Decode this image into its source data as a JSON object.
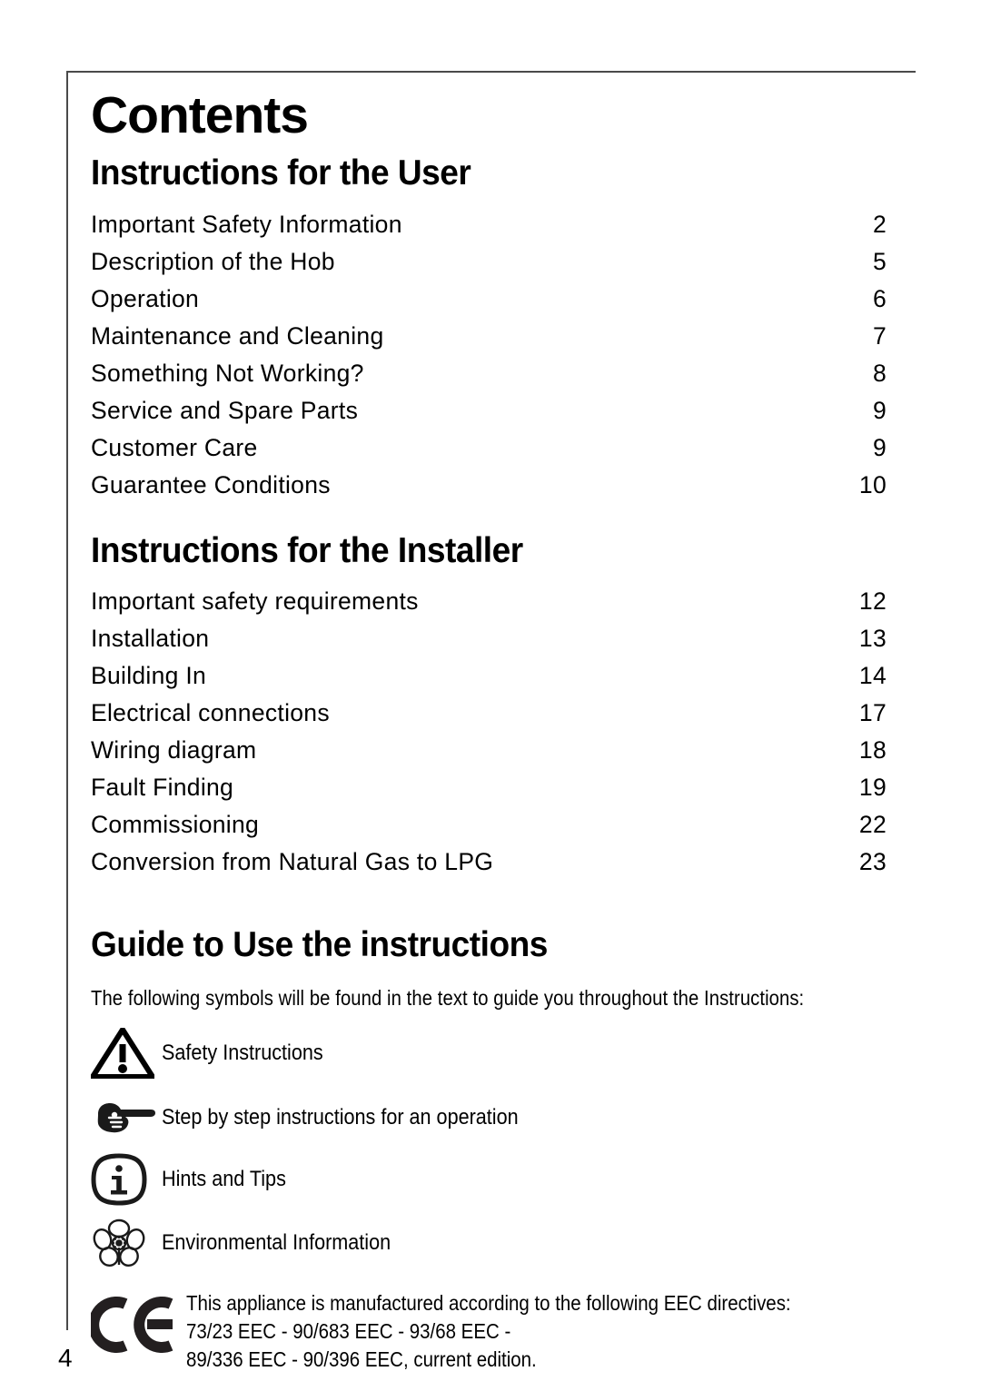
{
  "document": {
    "title": "Contents",
    "folio": "4"
  },
  "sections": [
    {
      "heading": "Instructions for the User",
      "entries": [
        {
          "label": "Important Safety Information",
          "page": "2"
        },
        {
          "label": "Description of the Hob",
          "page": "5"
        },
        {
          "label": "Operation",
          "page": "6"
        },
        {
          "label": "Maintenance and Cleaning",
          "page": "7"
        },
        {
          "label": "Something Not Working?",
          "page": "8"
        },
        {
          "label": "Service and Spare Parts",
          "page": "9"
        },
        {
          "label": "Customer Care",
          "page": "9"
        },
        {
          "label": "Guarantee Conditions",
          "page": "10"
        }
      ]
    },
    {
      "heading": "Instructions for the Installer",
      "entries": [
        {
          "label": "Important safety requirements",
          "page": "12"
        },
        {
          "label": "Installation",
          "page": "13"
        },
        {
          "label": "Building In",
          "page": "14"
        },
        {
          "label": "Electrical connections",
          "page": "17"
        },
        {
          "label": "Wiring diagram",
          "page": "18"
        },
        {
          "label": "Fault Finding",
          "page": "19"
        },
        {
          "label": "Commissioning",
          "page": "22"
        },
        {
          "label": "Conversion from Natural Gas to LPG",
          "page": "23"
        }
      ]
    }
  ],
  "guide": {
    "heading": "Guide to Use the instructions",
    "intro": "The following symbols will be found in the text to guide you throughout the Instructions:",
    "symbols": [
      {
        "icon": "warning-triangle-icon",
        "label": "Safety Instructions"
      },
      {
        "icon": "pointing-hand-icon",
        "label": "Step by step instructions for an  operation"
      },
      {
        "icon": "info-square-icon",
        "label": "Hints and Tips"
      },
      {
        "icon": "flower-environment-icon",
        "label": "Environmental Information"
      }
    ]
  },
  "compliance": {
    "mark": "ce-mark-icon",
    "lines": [
      "This appliance is manufactured according to the following EEC directives:",
      "73/23 EEC - 90/683 EEC - 93/68 EEC -",
      "89/336 EEC - 90/396 EEC, current edition."
    ]
  },
  "colors": {
    "ink": "#000000",
    "rule": "#4a4a4a",
    "page": "#ffffff"
  }
}
